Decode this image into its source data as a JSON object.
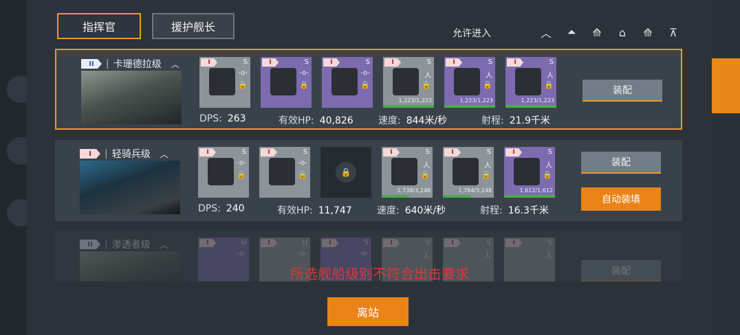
{
  "tabs": [
    "指挥官",
    "援护舰长"
  ],
  "filter": {
    "label": "允许进入",
    "icons": [
      "chevron-up-icon",
      "tier1-icon",
      "tier2-icon",
      "tier3-icon",
      "tier4-icon",
      "tier5-icon"
    ]
  },
  "ships": [
    {
      "tier": "II",
      "name": "卡珊德拉级",
      "slots": [
        {
          "type": "gray",
          "letter": "S",
          "glyph": "-o-",
          "locked": true
        },
        {
          "type": "purple",
          "letter": "S",
          "glyph": "-o-",
          "locked": true
        },
        {
          "type": "purple",
          "letter": "S",
          "glyph": "-o-",
          "locked": true
        },
        {
          "type": "gray",
          "letter": "S",
          "glyph": "人",
          "locked": true,
          "hp": "1,223/1,223",
          "fill": 1.0
        },
        {
          "type": "purple",
          "letter": "S",
          "glyph": "人",
          "locked": true,
          "hp": "1,223/1,223",
          "fill": 1.0
        },
        {
          "type": "purple",
          "letter": "S",
          "glyph": "人",
          "locked": true,
          "hp": "1,223/1,223",
          "fill": 1.0
        }
      ],
      "dps_label": "DPS:",
      "dps": "263",
      "hp_label": "有效HP:",
      "hp": "40,826",
      "speed_label": "速度:",
      "speed": "844米/秒",
      "range_label": "射程:",
      "range": "21.9千米",
      "buttons": [
        "装配"
      ]
    },
    {
      "tier": "I",
      "name": "轻骑兵级",
      "slots": [
        {
          "type": "gray",
          "letter": "S",
          "glyph": "-o-",
          "locked": true
        },
        {
          "type": "gray",
          "letter": "S",
          "glyph": "-o-",
          "locked": true
        },
        {
          "type": "empty"
        },
        {
          "type": "gray",
          "letter": "S",
          "glyph": "人",
          "locked": true,
          "hp": "1,738/3,248",
          "fill": 0.54
        },
        {
          "type": "gray",
          "letter": "S",
          "glyph": "人",
          "locked": true,
          "hp": "1,784/3,248",
          "fill": 0.55
        },
        {
          "type": "purple",
          "letter": "S",
          "glyph": "人",
          "locked": true,
          "hp": "1,612/1,612",
          "fill": 1.0
        }
      ],
      "dps_label": "DPS:",
      "dps": "240",
      "hp_label": "有效HP:",
      "hp": "11,747",
      "speed_label": "速度:",
      "speed": "640米/秒",
      "range_label": "射程:",
      "range": "16.3千米",
      "buttons": [
        "装配",
        "自动装填"
      ]
    },
    {
      "tier": "II",
      "name": "渗透者级",
      "slots": [
        {
          "type": "purple",
          "letter": "U",
          "glyph": "-o-",
          "locked": true
        },
        {
          "type": "gray",
          "letter": "U",
          "glyph": "-o-",
          "locked": true
        },
        {
          "type": "purple",
          "letter": "S",
          "glyph": "-o-",
          "locked": true
        },
        {
          "type": "gray",
          "letter": "S",
          "glyph": "人",
          "locked": true
        },
        {
          "type": "gray",
          "letter": "S",
          "glyph": "人",
          "locked": true
        },
        {
          "type": "gray",
          "letter": "S",
          "glyph": "人",
          "locked": true
        }
      ],
      "buttons": [
        "装配"
      ]
    }
  ],
  "warning": "所选舰船级别不符合出击要求",
  "depart_button": "离站"
}
